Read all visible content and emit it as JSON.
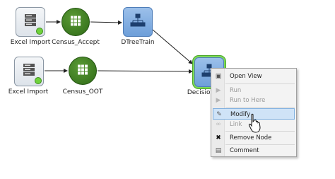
{
  "canvas": {
    "nodes": [
      {
        "id": "excel-import-1",
        "label": "Excel Import",
        "icon": "server-icon"
      },
      {
        "id": "census-accept",
        "label": "Census_Accept",
        "icon": "grid-icon"
      },
      {
        "id": "dtreetrain",
        "label": "DTreeTrain",
        "icon": "tree-icon"
      },
      {
        "id": "excel-import-2",
        "label": "Excel Import",
        "icon": "server-icon"
      },
      {
        "id": "census-oot",
        "label": "Census_OOT",
        "icon": "grid-icon"
      },
      {
        "id": "decision",
        "label": "Decision",
        "icon": "tree-icon"
      }
    ]
  },
  "context_menu": {
    "items": [
      {
        "label": "Open View",
        "icon": "open-view-icon",
        "enabled": true
      },
      {
        "label": "Run",
        "icon": "run-icon",
        "enabled": false
      },
      {
        "label": "Run to Here",
        "icon": "run-to-here-icon",
        "enabled": false
      },
      {
        "label": "Modify",
        "icon": "modify-icon",
        "enabled": true,
        "highlighted": true
      },
      {
        "label": "Link",
        "icon": "link-icon",
        "enabled": false
      },
      {
        "label": "Remove Node",
        "icon": "remove-icon",
        "enabled": true
      },
      {
        "label": "Comment",
        "icon": "comment-icon",
        "enabled": true
      }
    ]
  },
  "colors": {
    "accent_green": "#2f6b17",
    "node_blue": "#6e9fd9",
    "status_green": "#6fd23c",
    "menu_highlight": "#cfe3f7"
  }
}
